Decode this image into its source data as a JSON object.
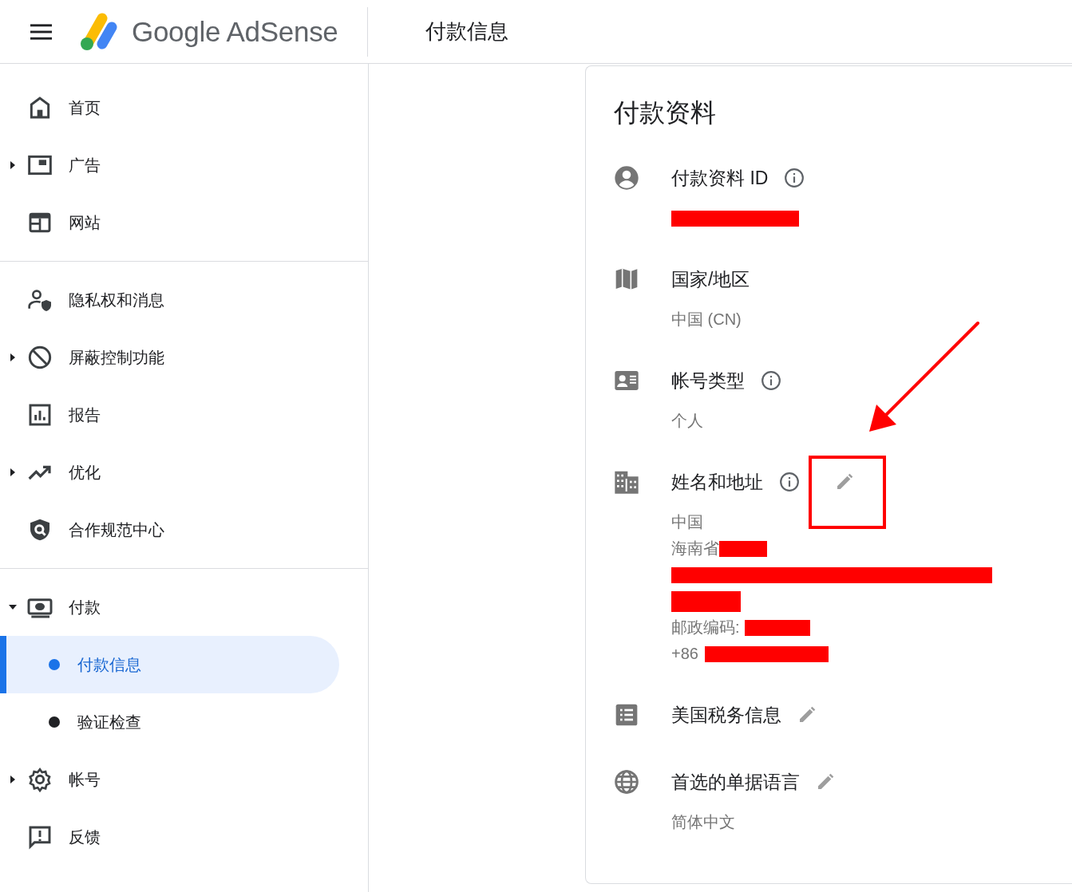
{
  "header": {
    "product": "Google AdSense",
    "page_title": "付款信息"
  },
  "sidebar": {
    "groups": [
      {
        "items": [
          {
            "label": "首页"
          },
          {
            "label": "广告",
            "expanded": false
          },
          {
            "label": "网站"
          }
        ]
      },
      {
        "items": [
          {
            "label": "隐私权和消息"
          },
          {
            "label": "屏蔽控制功能",
            "expanded": false
          },
          {
            "label": "报告"
          },
          {
            "label": "优化",
            "expanded": false
          },
          {
            "label": "合作规范中心"
          }
        ]
      },
      {
        "items": [
          {
            "label": "付款",
            "expanded": true,
            "children": [
              {
                "label": "付款信息",
                "selected": true
              },
              {
                "label": "验证检查",
                "selected": false
              }
            ]
          },
          {
            "label": "帐号",
            "expanded": false
          },
          {
            "label": "反馈"
          }
        ]
      }
    ]
  },
  "card": {
    "title": "付款资料",
    "sections": [
      {
        "label": "付款资料 ID",
        "info": true,
        "lines": [
          {
            "kind": "redacted"
          }
        ]
      },
      {
        "label": "国家/地区",
        "lines": [
          {
            "kind": "text",
            "text": "中国 (CN)"
          }
        ]
      },
      {
        "label": "帐号类型",
        "info": true,
        "lines": [
          {
            "kind": "text",
            "text": "个人"
          }
        ]
      },
      {
        "label": "姓名和地址",
        "info": true,
        "editable": true,
        "lines": [
          {
            "kind": "text",
            "text": "中国"
          },
          {
            "kind": "partly_redacted",
            "text": "海南省"
          },
          {
            "kind": "redacted"
          },
          {
            "kind": "redacted"
          },
          {
            "kind": "partly_redacted",
            "text": "邮政编码:"
          },
          {
            "kind": "partly_redacted",
            "text": "+86"
          }
        ]
      },
      {
        "label": "美国税务信息",
        "editable": true
      },
      {
        "label": "首选的单据语言",
        "editable": true,
        "lines": [
          {
            "kind": "text",
            "text": "简体中文"
          }
        ]
      }
    ]
  },
  "annotations": {
    "arrow": true,
    "highlight_frame": true
  }
}
